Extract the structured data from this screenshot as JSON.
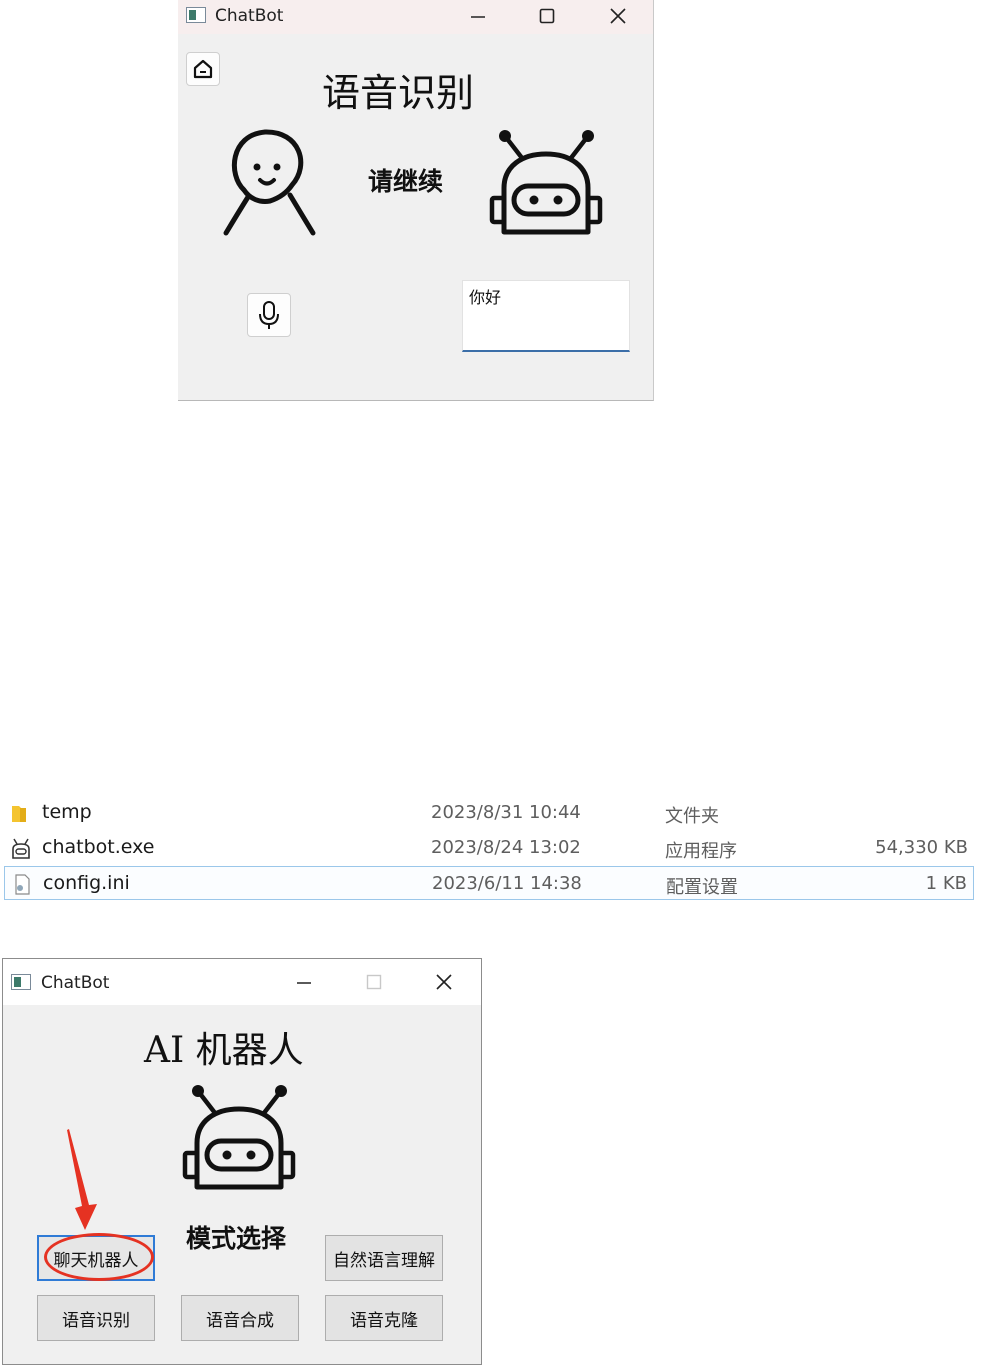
{
  "window1": {
    "title": "ChatBot",
    "heading": "语音识别",
    "status": "请继续",
    "input_value": "你好"
  },
  "file_list": [
    {
      "name": "temp",
      "date": "2023/8/31 10:44",
      "type": "文件夹",
      "size": "",
      "icon": "folder-icon"
    },
    {
      "name": "chatbot.exe",
      "date": "2023/8/24 13:02",
      "type": "应用程序",
      "size": "54,330 KB",
      "icon": "robot-app-icon"
    },
    {
      "name": "config.ini",
      "date": "2023/6/11 14:38",
      "type": "配置设置",
      "size": "1 KB",
      "icon": "config-file-icon",
      "selected": true
    }
  ],
  "window2": {
    "title": "ChatBot",
    "heading": "AI 机器人",
    "mode_label": "模式选择",
    "buttons": {
      "chat": "聊天机器人",
      "nlu": "自然语言理解",
      "asr": "语音识别",
      "tts": "语音合成",
      "clone": "语音克隆"
    }
  },
  "colors": {
    "annotation": "#e53222",
    "focus": "#2f7bd6",
    "window_bg": "#f0f0f0"
  }
}
